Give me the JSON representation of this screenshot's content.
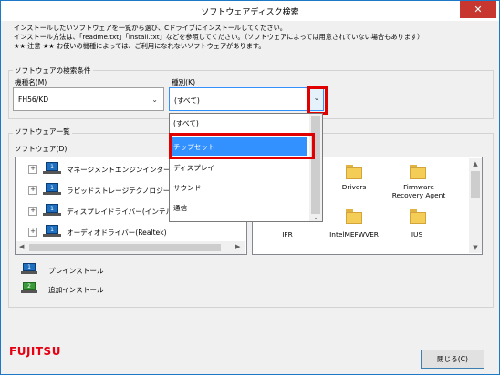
{
  "window": {
    "title": "ソフトウェアディスク検索",
    "close_glyph": "✕"
  },
  "description": {
    "line1": "インストールしたいソフトウェアを一覧から選び、Cドライブにインストールしてください。",
    "line2": "インストール方法は、「readme.txt」「install.txt」などを参照してください。（ソフトウェアによっては用意されていない場合もあります）",
    "line3": "★★ 注意 ★★ お使いの機種によっては、ご利用になれないソフトウェアがあります。"
  },
  "search": {
    "group_label": "ソフトウェアの検索条件",
    "model_label": "機種名(M)",
    "model_value": "FH56/KD",
    "type_label": "種別(K)",
    "type_value": "(すべて)"
  },
  "dropdown": {
    "options": [
      "(すべて)",
      "チップセット",
      "ディスプレイ",
      "サウンド",
      "通信"
    ],
    "selected_index": 1
  },
  "list": {
    "group_label": "ソフトウェア一覧",
    "software_label": "ソフトウェア(D)",
    "items": [
      "マネージメントエンジンインターフ",
      "ラピッドストレージテクノロジー(イ",
      "ディスプレイドライバー(インテル",
      "オーディオドライバー(Realtek)"
    ],
    "icon_text": "1"
  },
  "files": {
    "items": [
      "Drivers",
      "Firmware\nRecovery Agent",
      "IFR",
      "IntelMEFWVER",
      "IUS"
    ]
  },
  "legend": {
    "preinstall_label": "プレインストール",
    "preinstall_num": "1",
    "additional_label": "追加インストール",
    "additional_num": "2"
  },
  "buttons": {
    "close_label": "閉じる(C)"
  },
  "branding": {
    "logo_text": "FUJITSU"
  },
  "colors": {
    "accent": "#3390ff",
    "highlight_border": "#e00000",
    "brand": "#e60012",
    "preinstall_icon": "#1f6fbf",
    "additional_icon": "#3a9a3a"
  }
}
